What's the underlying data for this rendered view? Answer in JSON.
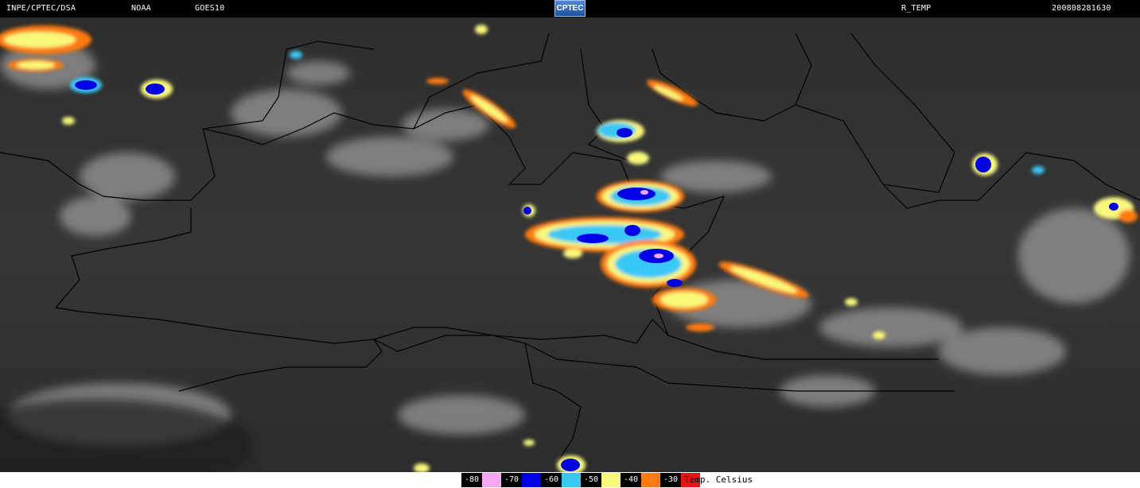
{
  "header": {
    "source": "INPE/CPTEC/DSA",
    "agency": "NOAA",
    "satellite": "GOES10",
    "logo_text": "CPTEC",
    "product": "R_TEMP",
    "datetime": "200808281630"
  },
  "legend": {
    "items": [
      {
        "label": "-80",
        "color": "#f5a8f0"
      },
      {
        "label": "-70",
        "color": "#0000e6"
      },
      {
        "label": "-60",
        "color": "#38c8f5"
      },
      {
        "label": "-50",
        "color": "#f8f87a"
      },
      {
        "label": "-40",
        "color": "#ff7a10"
      },
      {
        "label": "-30",
        "color": "#e81414"
      }
    ],
    "unit": "Temp. Celsius"
  },
  "colors": {
    "background": "#000000",
    "land": "#3a3a3a",
    "cloud": "#bdbdbd",
    "border": "#000000"
  }
}
